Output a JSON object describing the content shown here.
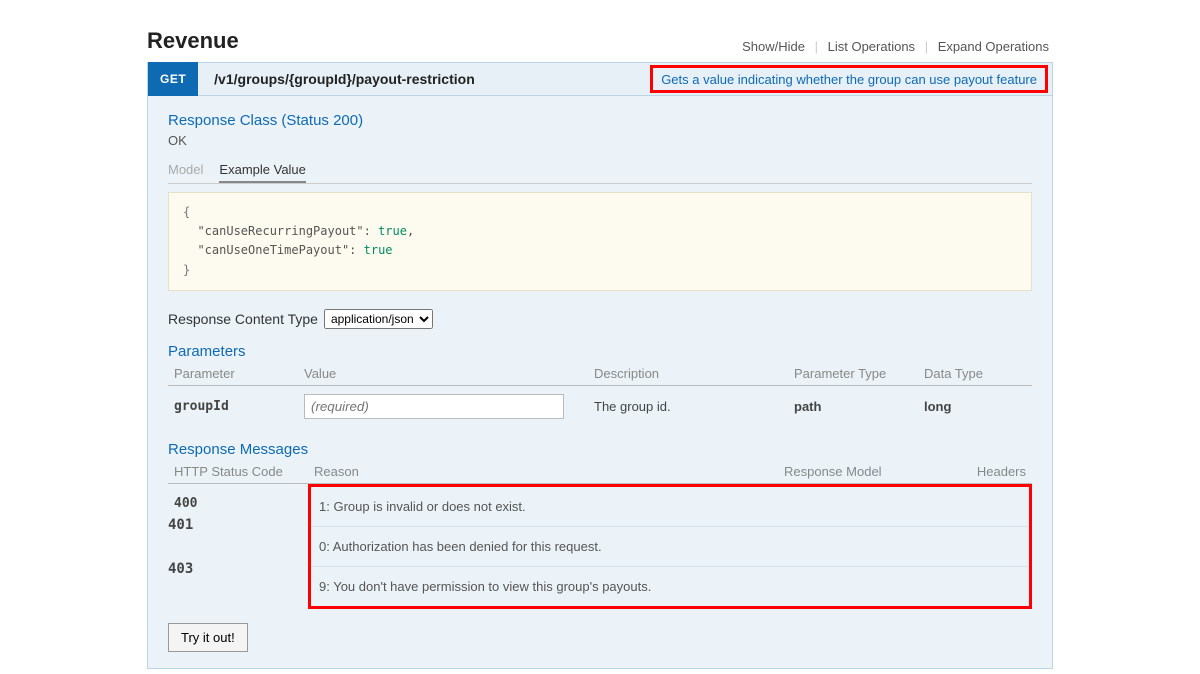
{
  "section_title": "Revenue",
  "toolbar": {
    "showhide": "Show/Hide",
    "listops": "List Operations",
    "expandops": "Expand Operations"
  },
  "operation": {
    "method": "GET",
    "path": "/v1/groups/{groupId}/payout-restriction",
    "summary": "Gets a value indicating whether the group can use payout feature"
  },
  "response_class": {
    "heading": "Response Class (Status 200)",
    "status_text": "OK",
    "tabs": {
      "model": "Model",
      "example": "Example Value"
    },
    "example_lines": [
      "{",
      "  \"canUseRecurringPayout\": true,",
      "  \"canUseOneTimePayout\": true",
      "}"
    ]
  },
  "content_type": {
    "label": "Response Content Type",
    "value": "application/json"
  },
  "parameters": {
    "heading": "Parameters",
    "headers": {
      "param": "Parameter",
      "value": "Value",
      "desc": "Description",
      "ptype": "Parameter Type",
      "dtype": "Data Type"
    },
    "rows": [
      {
        "name": "groupId",
        "required_placeholder": "(required)",
        "description": "The group id.",
        "ptype": "path",
        "dtype": "long"
      }
    ]
  },
  "responses": {
    "heading": "Response Messages",
    "headers": {
      "code": "HTTP Status Code",
      "reason": "Reason",
      "model": "Response Model",
      "hdrs": "Headers"
    },
    "rows": [
      {
        "code": "400",
        "reason": "1: Group is invalid or does not exist."
      },
      {
        "code": "401",
        "reason": "0: Authorization has been denied for this request."
      },
      {
        "code": "403",
        "reason": "9: You don't have permission to view this group's payouts."
      }
    ]
  },
  "tryit_label": "Try it out!"
}
